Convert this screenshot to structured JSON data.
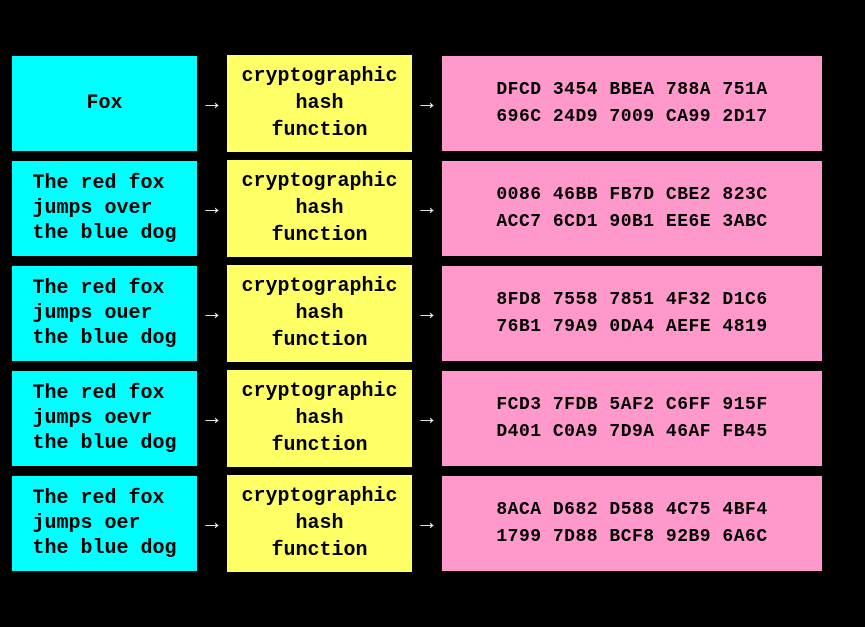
{
  "rows": [
    {
      "input": "Fox",
      "hash_label": "cryptographic\nhash\nfunction",
      "output_line1": "DFCD  3454  BBEA  788A  751A",
      "output_line2": "696C  24D9  7009  CA99  2D17"
    },
    {
      "input": "The red fox\njumps over\nthe blue dog",
      "hash_label": "cryptographic\nhash\nfunction",
      "output_line1": "0086  46BB  FB7D  CBE2  823C",
      "output_line2": "ACC7  6CD1  90B1  EE6E  3ABC"
    },
    {
      "input": "The red fox\njumps ouer\nthe blue dog",
      "hash_label": "cryptographic\nhash\nfunction",
      "output_line1": "8FD8  7558  7851  4F32  D1C6",
      "output_line2": "76B1  79A9  0DA4  AEFE  4819"
    },
    {
      "input": "The red fox\njumps oevr\nthe blue dog",
      "hash_label": "cryptographic\nhash\nfunction",
      "output_line1": "FCD3  7FDB  5AF2  C6FF  915F",
      "output_line2": "D401  C0A9  7D9A  46AF  FB45"
    },
    {
      "input": "The red fox\njumps oer\nthe blue dog",
      "hash_label": "cryptographic\nhash\nfunction",
      "output_line1": "8ACA  D682  D588  4C75  4BF4",
      "output_line2": "1799  7D88  BCF8  92B9  6A6C"
    }
  ],
  "arrow_symbol": "→"
}
